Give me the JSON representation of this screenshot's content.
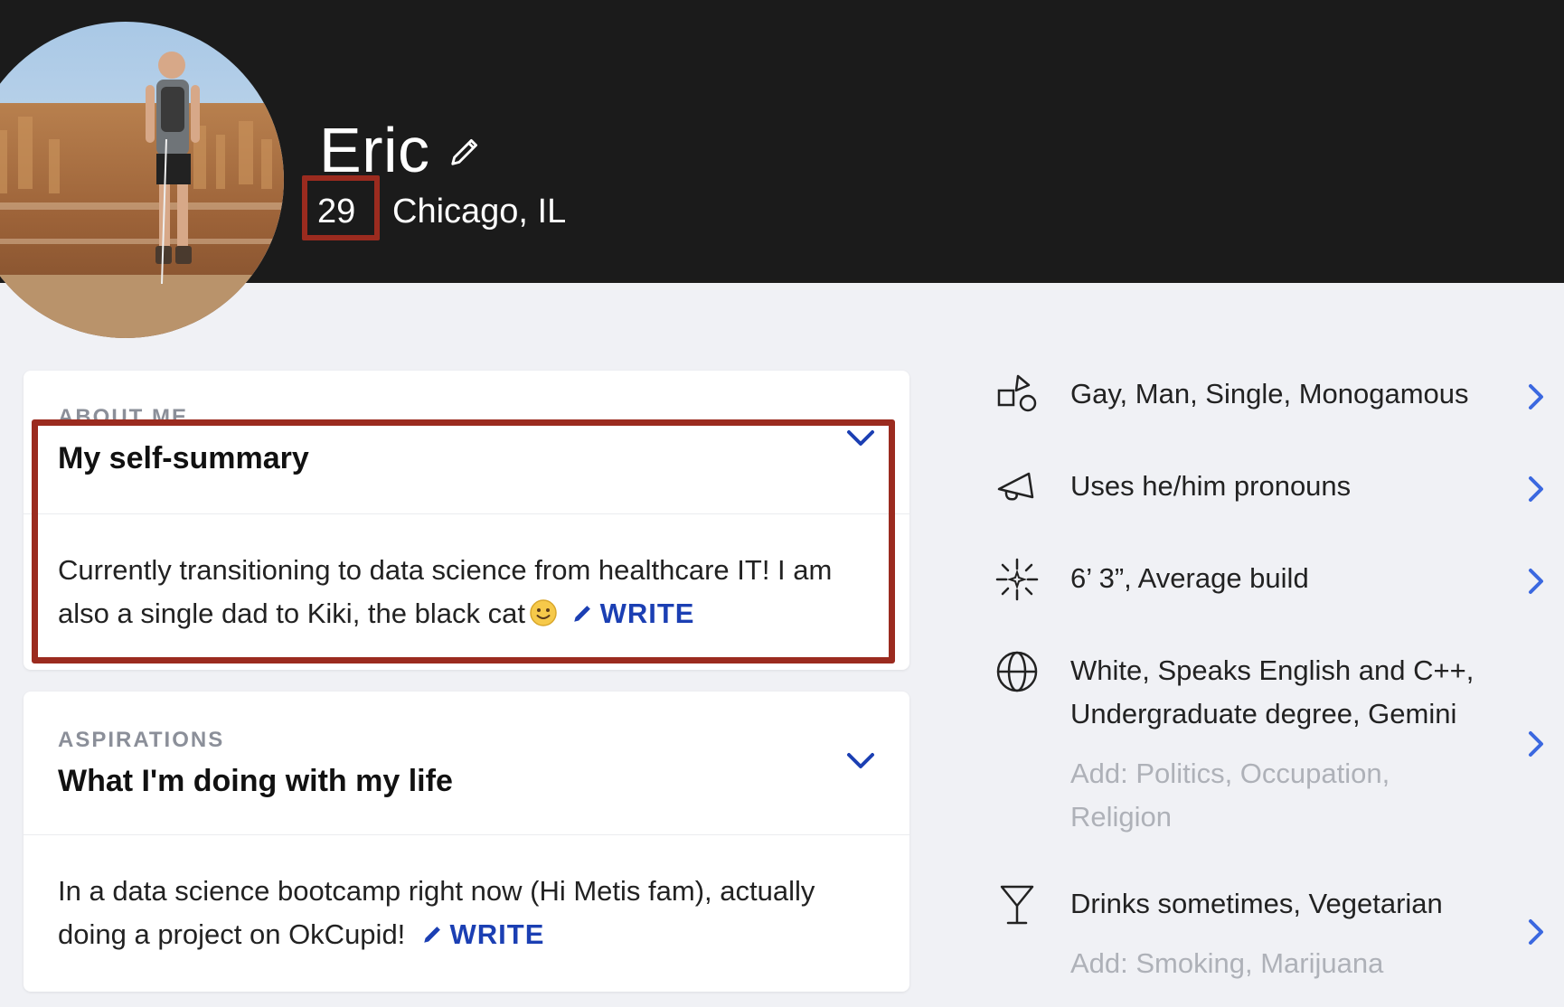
{
  "profile": {
    "name": "Eric",
    "age": "29",
    "location": "Chicago, IL"
  },
  "cards": {
    "about": {
      "eyebrow": "ABOUT ME",
      "heading": "My self-summary",
      "body": "Currently transitioning to data science from healthcare IT! I am also a single dad to Kiki, the black cat",
      "write_label": "WRITE"
    },
    "aspirations": {
      "eyebrow": "ASPIRATIONS",
      "heading": "What I'm doing with my life",
      "body": "In a data science bootcamp right now (Hi Metis fam), actually doing a project on OkCupid!",
      "write_label": "WRITE"
    }
  },
  "details": [
    {
      "icon": "shapes-icon",
      "text": "Gay, Man, Single, Monogamous"
    },
    {
      "icon": "megaphone-icon",
      "text": "Uses he/him pronouns"
    },
    {
      "icon": "sparkle-icon",
      "text": "6’ 3”, Average build"
    },
    {
      "icon": "globe-icon",
      "text": "White, Speaks English and C++, Undergraduate degree, Gemini",
      "add": "Add: Politics, Occupation, Religion"
    },
    {
      "icon": "cocktail-icon",
      "text": "Drinks sometimes, Vegetarian",
      "add": "Add: Smoking, Marijuana"
    }
  ],
  "colors": {
    "header_bg": "#1b1b1b",
    "page_bg": "#f0f1f5",
    "accent_blue": "#1b3fb3",
    "highlight_red": "#9b2b1f",
    "muted_text": "#aeb1b8"
  }
}
